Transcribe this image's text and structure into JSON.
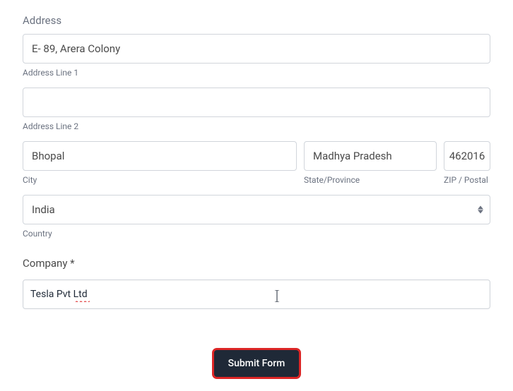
{
  "address": {
    "section_label": "Address",
    "line1": {
      "value": "E- 89, Arera Colony",
      "sub": "Address Line 1"
    },
    "line2": {
      "value": "",
      "sub": "Address Line 2"
    },
    "city": {
      "value": "Bhopal",
      "sub": "City"
    },
    "state": {
      "value": "Madhya Pradesh",
      "sub": "State/Province"
    },
    "zip": {
      "value": "462016",
      "sub": "ZIP / Postal"
    },
    "country": {
      "value": "India",
      "sub": "Country"
    }
  },
  "company": {
    "label": "Company *",
    "value": "Tesla Pvt Ltd"
  },
  "submit": {
    "label": "Submit Form"
  }
}
